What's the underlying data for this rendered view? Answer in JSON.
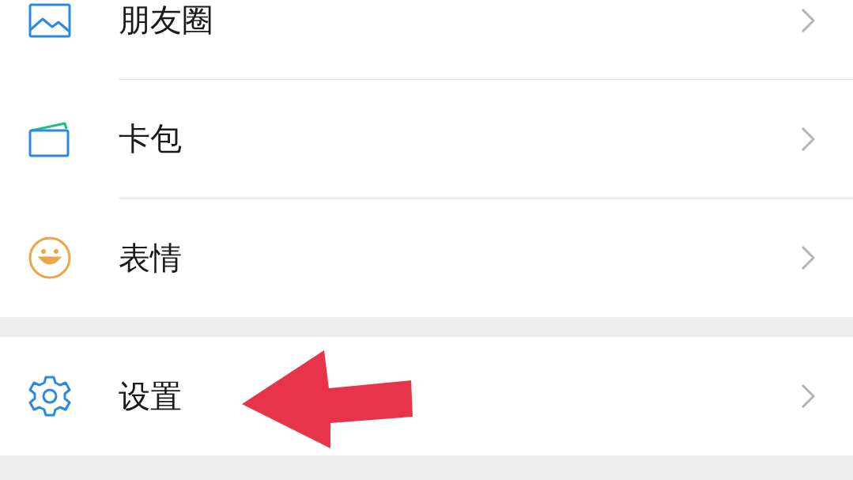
{
  "sections": [
    {
      "items": [
        {
          "label": "朋友圈",
          "kind": "moments"
        },
        {
          "label": "卡包",
          "kind": "cards"
        },
        {
          "label": "表情",
          "kind": "stickers"
        }
      ]
    },
    {
      "items": [
        {
          "label": "设置",
          "kind": "settings"
        }
      ]
    }
  ]
}
